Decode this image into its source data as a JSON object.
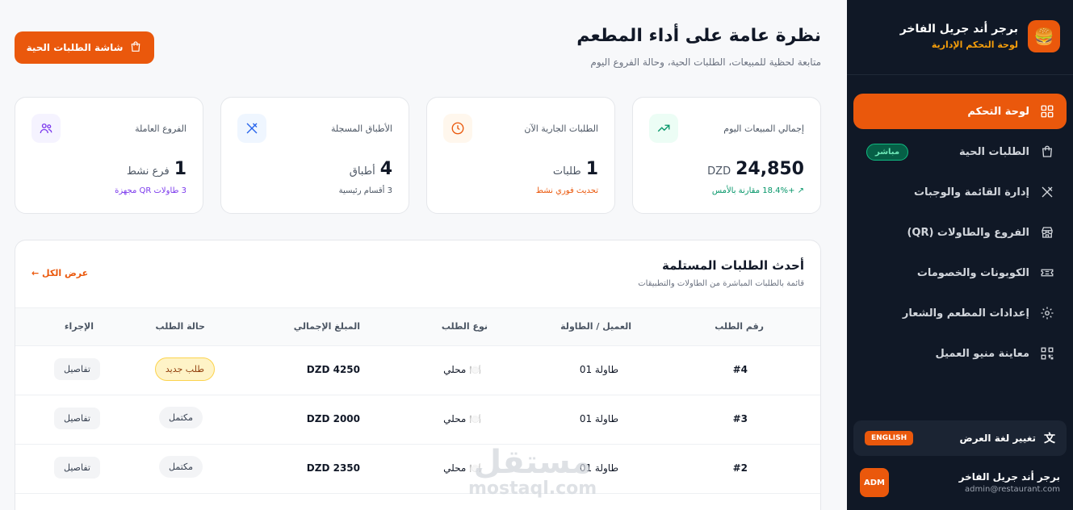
{
  "sidebar": {
    "brand_name": "برجر أند جريل الفاخر",
    "brand_sub": "لوحة التحكم الإدارية",
    "items": [
      {
        "label": "لوحة التحكم"
      },
      {
        "label": "الطلبات الحية",
        "badge": "مباشر"
      },
      {
        "label": "إدارة القائمة والوجبات"
      },
      {
        "label": "الفروع والطاولات (QR)"
      },
      {
        "label": "الكوبونات والخصومات"
      },
      {
        "label": "إعدادات المطعم والشعار"
      },
      {
        "label": "معاينة منيو العميل"
      }
    ],
    "lang_label": "تغيير لغة العرض",
    "lang_button": "ENGLISH",
    "user_name": "برجر أند جريل الفاخر",
    "user_email": "admin@restaurant.com",
    "avatar": "ADM"
  },
  "header": {
    "title": "نظرة عامة على أداء المطعم",
    "subtitle": "متابعة لحظية للمبيعات، الطلبات الحية، وحالة الفروع اليوم",
    "live_button": "شاشة الطلبات الحية"
  },
  "stats": [
    {
      "label": "إجمالي المبيعات اليوم",
      "value": "24,850",
      "unit": "DZD",
      "foot": "↗ +18.4% مقارنة بالأمس",
      "color": "#059669"
    },
    {
      "label": "الطلبات الجارية الآن",
      "value": "1",
      "unit": "طلبات",
      "foot": "تحديث فوري نشط",
      "color": "#ea580c"
    },
    {
      "label": "الأطباق المسجلة",
      "value": "4",
      "unit": "أطباق",
      "foot": "3 أقسام رئيسية",
      "color": "#4b5563"
    },
    {
      "label": "الفروع العاملة",
      "value": "1",
      "unit": "فرع نشط",
      "foot": "3 طاولات QR مجهزة",
      "color": "#7c3aed"
    }
  ],
  "orders": {
    "title": "أحدث الطلبات المستلمة",
    "subtitle": "قائمة بالطلبات المباشرة من الطاولات والتطبيقات",
    "view_all": "عرض الكل ←",
    "columns": [
      "رقم الطلب",
      "العميل / الطاولة",
      "نوع الطلب",
      "المبلغ الإجمالي",
      "حالة الطلب",
      "الإجراء"
    ],
    "rows": [
      {
        "id": "#4",
        "table": "طاولة 01",
        "type": "🍽️ محلي",
        "amount": "DZD 4250",
        "status": "طلب جديد",
        "action": "تفاصيل"
      },
      {
        "id": "#3",
        "table": "طاولة 01",
        "type": "🍽️ محلي",
        "amount": "DZD 2000",
        "status": "مكتمل",
        "action": "تفاصيل"
      },
      {
        "id": "#2",
        "table": "طاولة 01",
        "type": "🍽️ محلي",
        "amount": "DZD 2350",
        "status": "مكتمل",
        "action": "تفاصيل"
      }
    ]
  },
  "watermark": {
    "ar": "مستقل",
    "en": "mostaql.com"
  }
}
